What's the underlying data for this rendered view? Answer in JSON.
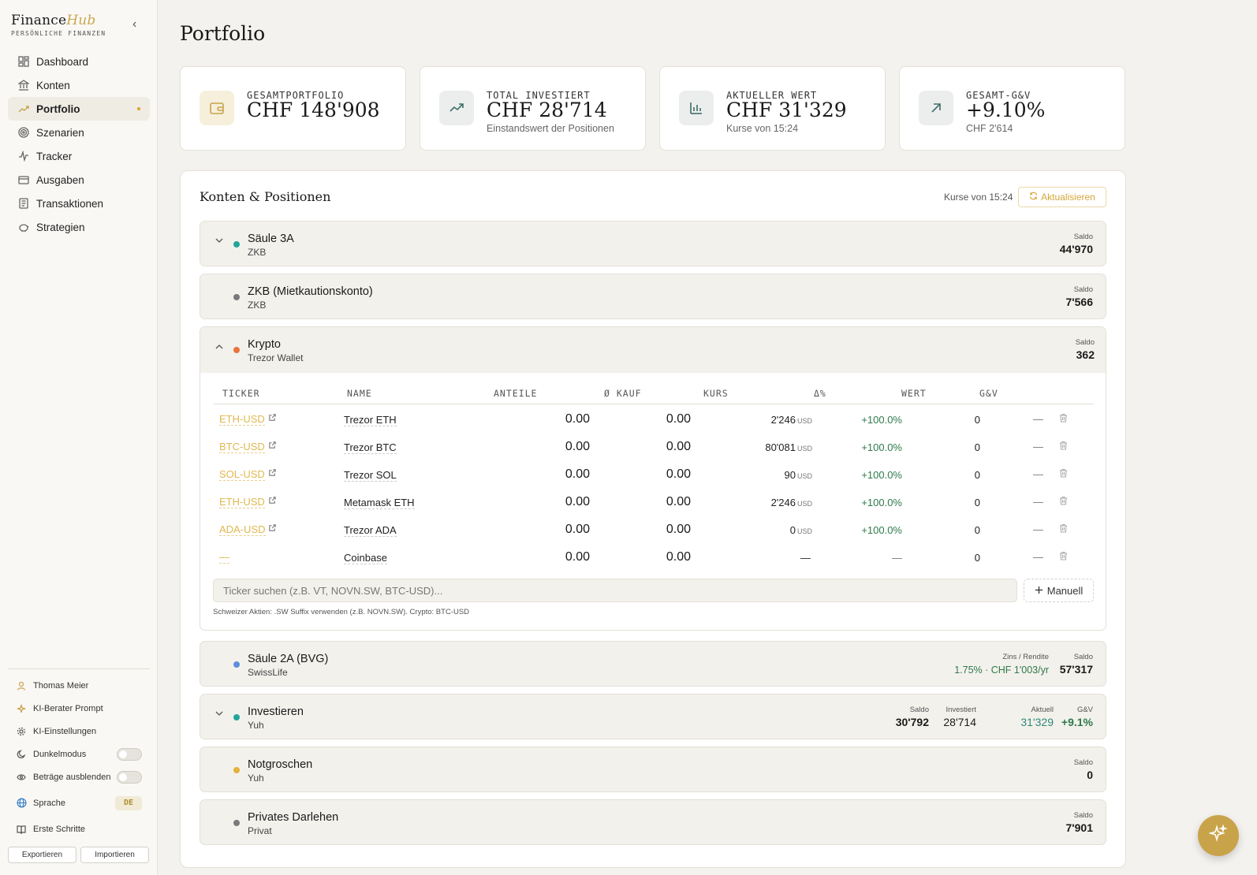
{
  "brand": {
    "name_a": "Finance",
    "name_b": "Hub",
    "tagline": "PERSÖNLICHE FINANZEN",
    "collapse": "‹"
  },
  "nav": [
    {
      "label": "Dashboard",
      "icon": "dashboard-icon"
    },
    {
      "label": "Konten",
      "icon": "bank-icon"
    },
    {
      "label": "Portfolio",
      "icon": "trend-icon",
      "active": true
    },
    {
      "label": "Szenarien",
      "icon": "target-icon"
    },
    {
      "label": "Tracker",
      "icon": "pulse-icon"
    },
    {
      "label": "Ausgaben",
      "icon": "card-icon"
    },
    {
      "label": "Transaktionen",
      "icon": "receipt-icon"
    },
    {
      "label": "Strategien",
      "icon": "piggy-icon"
    }
  ],
  "sidebar_bottom": {
    "user": "Thomas Meier",
    "ai_prompt": "KI-Berater Prompt",
    "ai_settings": "KI-Einstellungen",
    "dark_mode": "Dunkelmodus",
    "hide_amounts": "Beträge ausblenden",
    "language": "Sprache",
    "language_value": "DE",
    "getting_started": "Erste Schritte",
    "export": "Exportieren",
    "import": "Importieren"
  },
  "page_title": "Portfolio",
  "stats": [
    {
      "label": "GESAMTPORTFOLIO",
      "value": "CHF 148'908",
      "sub": "",
      "icon": "wallet-icon",
      "bg": "#f6efdc",
      "fg": "#c9a34a"
    },
    {
      "label": "TOTAL INVESTIERT",
      "value": "CHF 28'714",
      "sub": "Einstandswert der Positionen",
      "icon": "trending-up-icon",
      "bg": "#eceeed",
      "fg": "#3c6e68"
    },
    {
      "label": "AKTUELLER WERT",
      "value": "CHF 31'329",
      "sub": "Kurse von 15:24",
      "icon": "bar-chart-icon",
      "bg": "#eceeed",
      "fg": "#3c6e68"
    },
    {
      "label": "GESAMT-G&V",
      "value": "+9.10%",
      "sub": "CHF 2'614",
      "icon": "arrow-up-right-icon",
      "bg": "#eceeed",
      "fg": "#3c6e68"
    }
  ],
  "panel": {
    "title": "Konten & Positionen",
    "kurse": "Kurse von 15:24",
    "refresh": "Aktualisieren"
  },
  "accounts": [
    {
      "name": "Säule 3A",
      "sub": "ZKB",
      "dot": "#22a59a",
      "chevron": "⌄",
      "saldo_label": "Saldo",
      "saldo": "44'970"
    },
    {
      "name": "ZKB (Mietkautionskonto)",
      "sub": "ZKB",
      "dot": "#7a7a7a",
      "chevron": "",
      "saldo_label": "Saldo",
      "saldo": "7'566"
    },
    {
      "name": "Krypto",
      "sub": "Trezor Wallet",
      "dot": "#e8743b",
      "chevron": "⌃",
      "saldo_label": "Saldo",
      "saldo": "362"
    },
    {
      "name": "Säule 2A (BVG)",
      "sub": "SwissLife",
      "dot": "#5b8fd9",
      "chevron": "",
      "zins_label": "Zins / Rendite",
      "zins": "1.75% · CHF 1'003/yr",
      "saldo_label": "Saldo",
      "saldo": "57'317"
    },
    {
      "name": "Investieren",
      "sub": "Yuh",
      "dot": "#22a59a",
      "chevron": "⌄",
      "saldo_label": "Saldo",
      "saldo": "30'792",
      "inv_label": "Investiert",
      "inv": "28'714",
      "akt_label": "Aktuell",
      "akt": "31'329",
      "gv_label": "G&V",
      "gv": "+9.1%"
    },
    {
      "name": "Notgroschen",
      "sub": "Yuh",
      "dot": "#e3b23c",
      "chevron": "",
      "saldo_label": "Saldo",
      "saldo": "0"
    },
    {
      "name": "Privates Darlehen",
      "sub": "Privat",
      "dot": "#7a7a7a",
      "chevron": "",
      "saldo_label": "Saldo",
      "saldo": "7'901"
    }
  ],
  "table": {
    "headers": [
      "TICKER",
      "NAME",
      "ANTEILE",
      "Ø KAUF",
      "KURS",
      "Δ%",
      "WERT",
      "G&V"
    ],
    "rows": [
      {
        "ticker": "ETH-USD",
        "name": "Trezor ETH",
        "anteile": "0.00",
        "kauf": "0.00",
        "kurs": "2'246",
        "cur": "USD",
        "delta": "+100.0%",
        "wert": "0",
        "gv": "—"
      },
      {
        "ticker": "BTC-USD",
        "name": "Trezor BTC",
        "anteile": "0.00",
        "kauf": "0.00",
        "kurs": "80'081",
        "cur": "USD",
        "delta": "+100.0%",
        "wert": "0",
        "gv": "—"
      },
      {
        "ticker": "SOL-USD",
        "name": "Trezor SOL",
        "anteile": "0.00",
        "kauf": "0.00",
        "kurs": "90",
        "cur": "USD",
        "delta": "+100.0%",
        "wert": "0",
        "gv": "—"
      },
      {
        "ticker": "ETH-USD",
        "name": "Metamask ETH",
        "anteile": "0.00",
        "kauf": "0.00",
        "kurs": "2'246",
        "cur": "USD",
        "delta": "+100.0%",
        "wert": "0",
        "gv": "—"
      },
      {
        "ticker": "ADA-USD",
        "name": "Trezor ADA",
        "anteile": "0.00",
        "kauf": "0.00",
        "kurs": "0",
        "cur": "USD",
        "delta": "+100.0%",
        "wert": "0",
        "gv": "—"
      },
      {
        "ticker": "—",
        "name": "Coinbase",
        "anteile": "0.00",
        "kauf": "0.00",
        "kurs": "—",
        "cur": "",
        "delta": "—",
        "wert": "0",
        "gv": "—"
      }
    ],
    "search_placeholder": "Ticker suchen (z.B. VT, NOVN.SW, BTC-USD)...",
    "manual": "Manuell",
    "hint": "Schweizer Aktien: .SW Suffix verwenden (z.B. NOVN.SW). Crypto: BTC-USD"
  }
}
